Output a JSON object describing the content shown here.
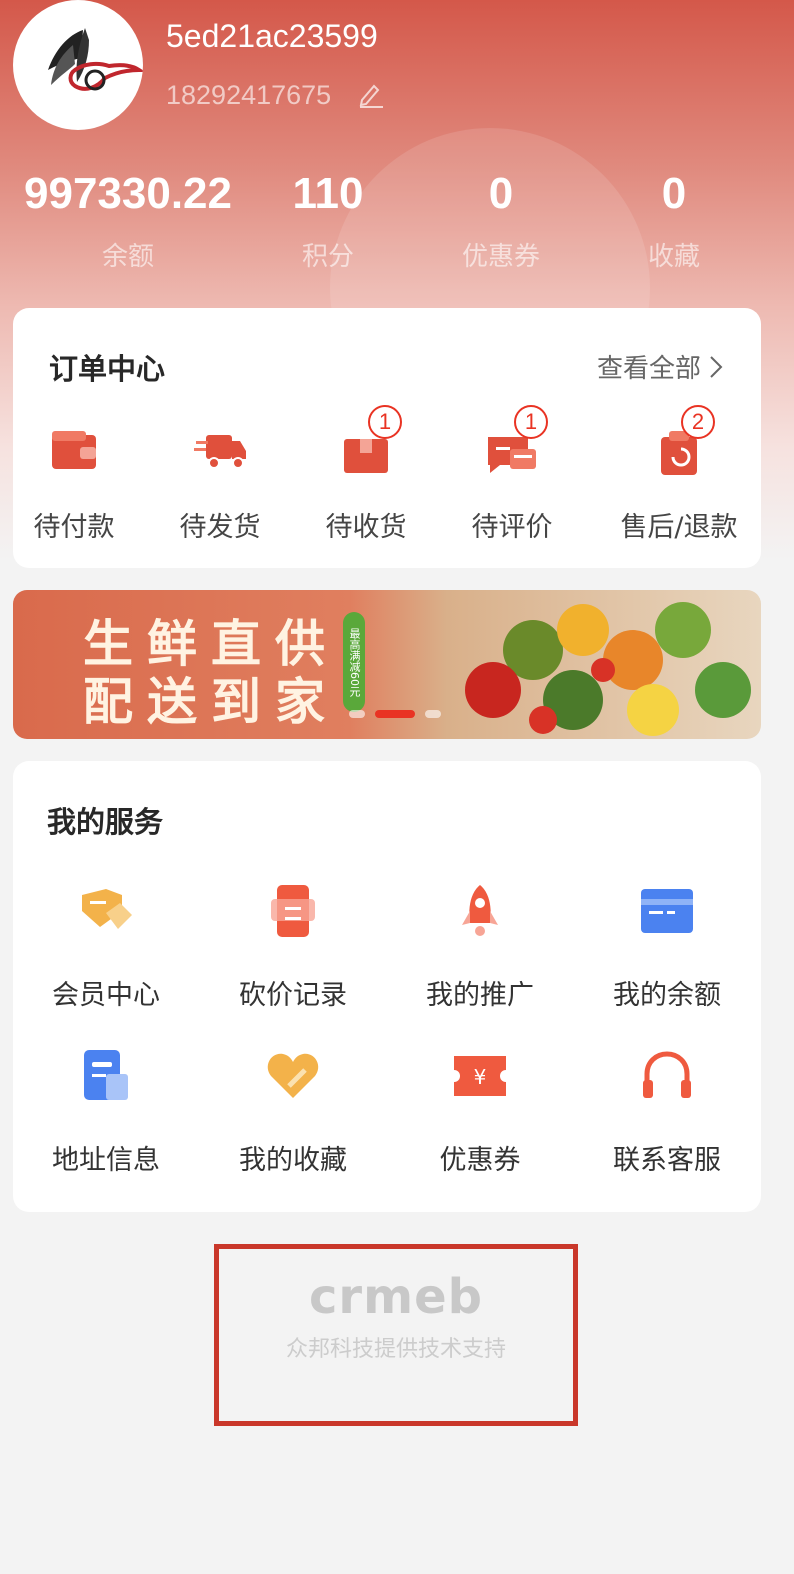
{
  "profile": {
    "username": "5ed21ac23599",
    "phone": "18292417675"
  },
  "stats": [
    {
      "value": "997330.22",
      "label": "余额"
    },
    {
      "value": "110",
      "label": "积分"
    },
    {
      "value": "0",
      "label": "优惠券"
    },
    {
      "value": "0",
      "label": "收藏"
    }
  ],
  "orders": {
    "title": "订单中心",
    "view_all": "查看全部",
    "items": [
      {
        "label": "待付款",
        "icon": "wallet-icon",
        "badge": ""
      },
      {
        "label": "待发货",
        "icon": "truck-icon",
        "badge": ""
      },
      {
        "label": "待收货",
        "icon": "package-icon",
        "badge": "1"
      },
      {
        "label": "待评价",
        "icon": "comment-icon",
        "badge": "1"
      },
      {
        "label": "售后/退款",
        "icon": "refund-icon",
        "badge": "2"
      }
    ]
  },
  "banner": {
    "line1": "生鲜直供",
    "line2": "配送到家",
    "tag": "最高满减60元"
  },
  "services": {
    "title": "我的服务",
    "items": [
      {
        "label": "会员中心",
        "icon": "vip-icon"
      },
      {
        "label": "砍价记录",
        "icon": "bargain-icon"
      },
      {
        "label": "我的推广",
        "icon": "rocket-icon"
      },
      {
        "label": "我的余额",
        "icon": "card-icon"
      },
      {
        "label": "地址信息",
        "icon": "address-icon"
      },
      {
        "label": "我的收藏",
        "icon": "heart-icon"
      },
      {
        "label": "优惠券",
        "icon": "coupon-icon"
      },
      {
        "label": "联系客服",
        "icon": "headset-icon"
      }
    ]
  },
  "footer": {
    "logo": "crmeb",
    "text": "众邦科技提供技术支持"
  },
  "colors": {
    "accent": "#e93323",
    "header": "#d4584a"
  }
}
